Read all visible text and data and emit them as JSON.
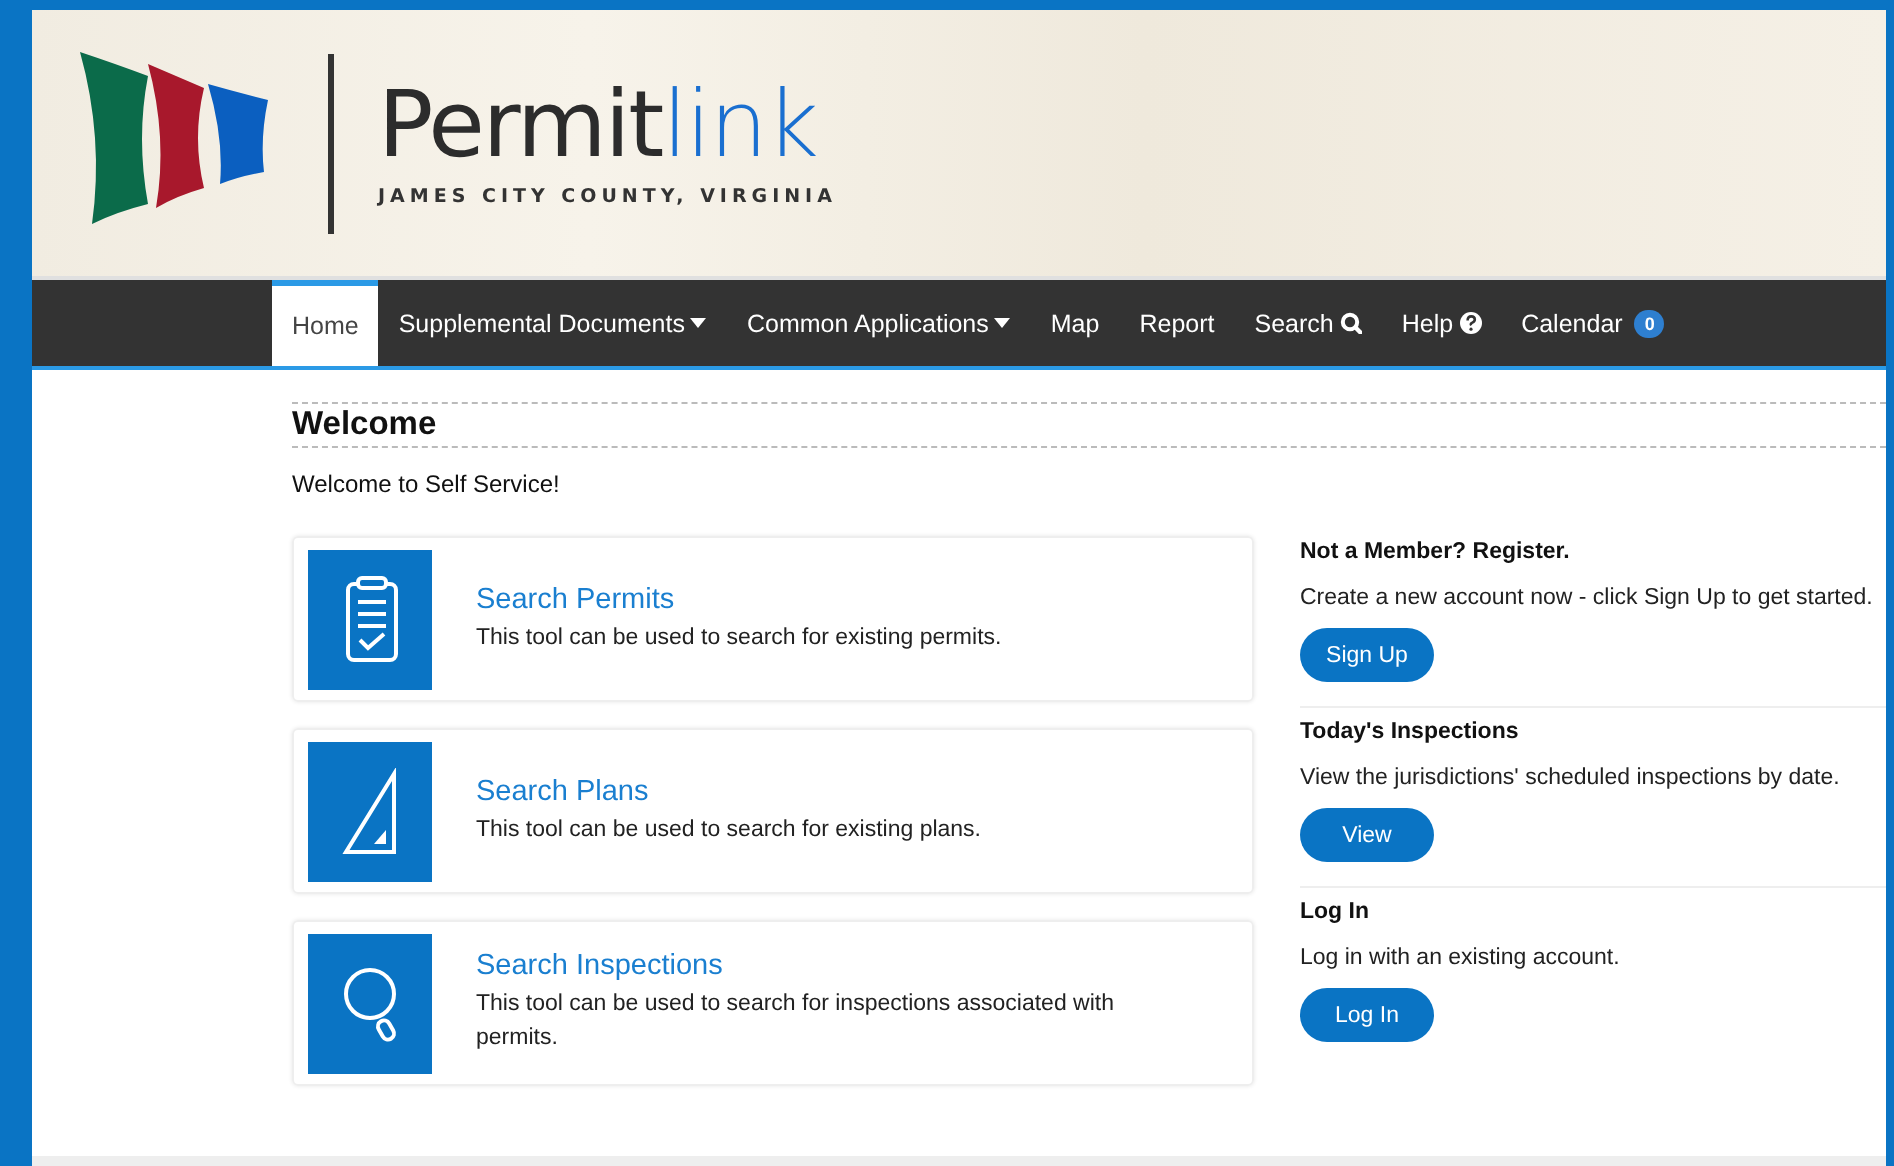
{
  "header": {
    "logo_main": "Permit",
    "logo_accent": "link",
    "logo_subtitle": "JAMES CITY COUNTY, VIRGINIA"
  },
  "nav": [
    {
      "label": "Home",
      "kind": "plain",
      "selected": true
    },
    {
      "label": "Supplemental Documents",
      "kind": "dropdown",
      "selected": false
    },
    {
      "label": "Common Applications",
      "kind": "dropdown",
      "selected": false
    },
    {
      "label": "Map",
      "kind": "plain",
      "selected": false
    },
    {
      "label": "Report",
      "kind": "plain",
      "selected": false
    },
    {
      "label": "Search",
      "kind": "search",
      "selected": false
    },
    {
      "label": "Help",
      "kind": "help",
      "selected": false
    },
    {
      "label": "Calendar",
      "kind": "badge",
      "badge": "0",
      "selected": false
    }
  ],
  "welcome": {
    "title": "Welcome",
    "text": "Welcome to Self Service!"
  },
  "tools": [
    {
      "kind": "clipboard",
      "title": "Search Permits",
      "description": "This tool can be used to search for existing permits."
    },
    {
      "kind": "triangle",
      "title": "Search Plans",
      "description": "This tool can be used to search for existing plans."
    },
    {
      "kind": "magnifier",
      "title": "Search Inspections",
      "description": "This tool can be used to search for inspections associated with permits."
    }
  ],
  "panels": [
    {
      "title": "Not a Member? Register.",
      "text": "Create a new account now - click Sign Up to get started.",
      "button": "Sign Up"
    },
    {
      "title": "Today's Inspections",
      "text": "View the jurisdictions' scheduled inspections by date.",
      "button": "View"
    },
    {
      "title": "Log In",
      "text": "Log in with an existing account.",
      "button": "Log In"
    }
  ]
}
